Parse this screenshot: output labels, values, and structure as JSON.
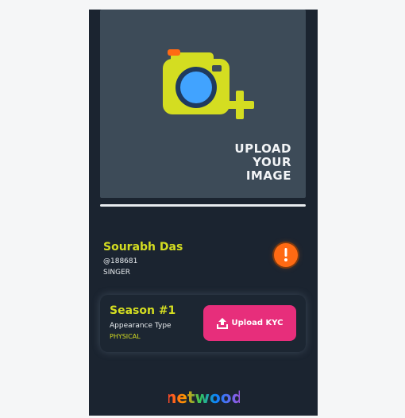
{
  "upload": {
    "line1": "UPLOAD",
    "line2": "YOUR",
    "line3": "IMAGE",
    "icon": "camera-add-icon"
  },
  "profile": {
    "name": "Sourabh Das",
    "id": "@188681",
    "role": "SINGER"
  },
  "alert": {
    "icon": "exclamation-icon",
    "color": "#ff6a13"
  },
  "season": {
    "title": "Season #1",
    "type_label": "Appearance Type",
    "type_value": "PHYSICAL"
  },
  "kyc": {
    "label": "Upload KYC",
    "icon": "upload-icon",
    "color": "#e72e7b"
  },
  "brand": {
    "logo_text": "netwood"
  },
  "colors": {
    "accent": "#d4dd21",
    "background": "#1b2430",
    "panel": "#3d4b58"
  }
}
